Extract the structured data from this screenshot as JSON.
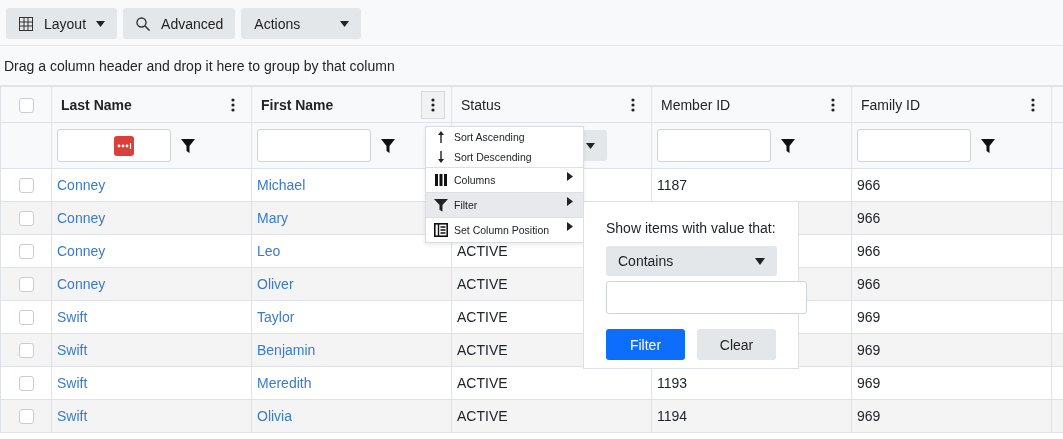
{
  "toolbar": [
    {
      "kind": "grid",
      "label": "Layout",
      "caret": true
    },
    {
      "kind": "search",
      "label": "Advanced",
      "caret": false
    },
    {
      "kind": "plain",
      "label": "Actions",
      "caret": true
    }
  ],
  "group_panel": "Drag a column header and drop it here to group by that column",
  "select_all": {
    "checked": false
  },
  "columns": [
    {
      "label": "Last Name",
      "bold": true,
      "menu_open": false,
      "kind": "text-filter",
      "autofill_icon": true
    },
    {
      "label": "First Name",
      "bold": true,
      "menu_open": true,
      "kind": "text-filter"
    },
    {
      "label": "Status",
      "bold": false,
      "menu_open": false,
      "kind": "dropdown-filter"
    },
    {
      "label": "Member ID",
      "bold": false,
      "menu_open": false,
      "kind": "text-filter"
    },
    {
      "label": "Family ID",
      "bold": false,
      "menu_open": false,
      "kind": "text-filter"
    }
  ],
  "rows": [
    {
      "checked": false,
      "cells": [
        "Conney",
        "Michael",
        null,
        "1187",
        "966"
      ]
    },
    {
      "checked": false,
      "cells": [
        "Conney",
        "Mary",
        null,
        null,
        "966"
      ]
    },
    {
      "checked": false,
      "cells": [
        "Conney",
        "Leo",
        "ACTIVE",
        null,
        "966"
      ]
    },
    {
      "checked": false,
      "cells": [
        "Conney",
        "Oliver",
        "ACTIVE",
        null,
        "966"
      ]
    },
    {
      "checked": false,
      "cells": [
        "Swift",
        "Taylor",
        "ACTIVE",
        null,
        "969"
      ]
    },
    {
      "checked": false,
      "cells": [
        "Swift",
        "Benjamin",
        "ACTIVE",
        null,
        "969"
      ]
    },
    {
      "checked": false,
      "cells": [
        "Swift",
        "Meredith",
        "ACTIVE",
        "1193",
        "969"
      ]
    },
    {
      "checked": false,
      "cells": [
        "Swift",
        "Olivia",
        "ACTIVE",
        "1194",
        "969"
      ]
    }
  ],
  "column_menu": {
    "items": [
      {
        "kind": "sort-up",
        "label": "Sort Ascending",
        "submenu": false,
        "selected": false
      },
      {
        "kind": "sort-down",
        "label": "Sort Descending",
        "submenu": false,
        "selected": false
      },
      {
        "kind": "columns",
        "label": "Columns",
        "submenu": true,
        "selected": false
      },
      {
        "kind": "filter",
        "label": "Filter",
        "submenu": true,
        "selected": true
      },
      {
        "kind": "position",
        "label": "Set Column Position",
        "submenu": true,
        "selected": false
      }
    ]
  },
  "filter_popup": {
    "prompt": "Show items with value that:",
    "operator": "Contains",
    "buttons": [
      {
        "kind": "primary",
        "label": "Filter"
      },
      {
        "kind": "secondary",
        "label": "Clear"
      }
    ]
  }
}
